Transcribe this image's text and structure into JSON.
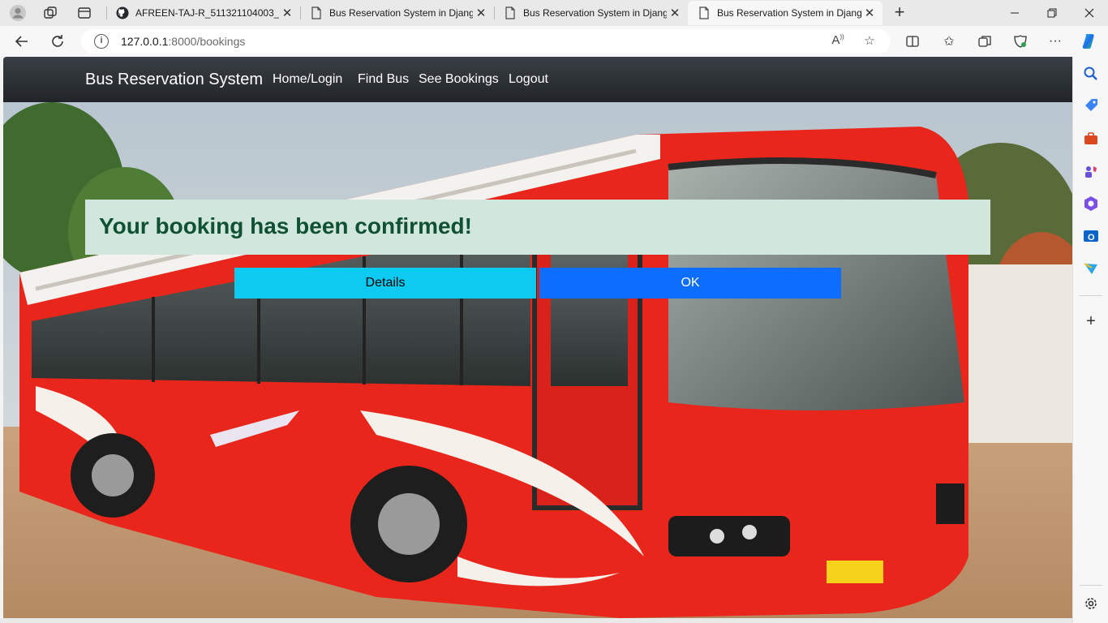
{
  "browser": {
    "tabs": [
      {
        "title": "AFREEN-TAJ-R_511321104003_N",
        "favicon": "github-icon"
      },
      {
        "title": "Bus Reservation System in Djang",
        "favicon": "page-icon"
      },
      {
        "title": "Bus Reservation System in Djang",
        "favicon": "page-icon"
      },
      {
        "title": "Bus Reservation System in Djang",
        "favicon": "page-icon"
      }
    ],
    "address": {
      "host": "127.0.0.1",
      "rest": ":8000/bookings"
    }
  },
  "page": {
    "brand": "Bus Reservation System",
    "nav": [
      "Home/Login",
      "Find Bus",
      "See Bookings",
      "Logout"
    ],
    "alert": "Your booking has been confirmed!",
    "buttons": {
      "details": "Details",
      "ok": "OK"
    }
  },
  "colors": {
    "navbar": "#212529",
    "alert_bg": "#d1e7dd",
    "alert_text": "#0f5132",
    "details_btn": "#0dcaf0",
    "ok_btn": "#0d6efd",
    "bus_red": "#e8261c"
  }
}
